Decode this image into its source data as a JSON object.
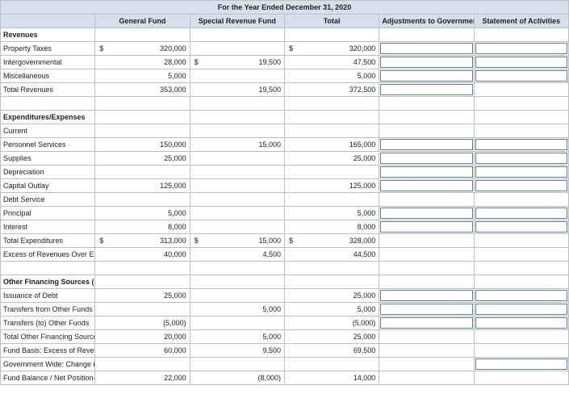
{
  "title": "For the Year Ended December 31, 2020",
  "columns": {
    "general": "General Fund",
    "special": "Special Revenue Fund",
    "total": "Total",
    "adjust": "Adjustments to Government-wide",
    "activities": "Statement of Activities"
  },
  "rows": [
    {
      "label": "Revenues",
      "style": "bold"
    },
    {
      "label": "Property Taxes",
      "g": "320,000",
      "gs": "$",
      "t": "320,000",
      "ts": "$",
      "inputs": [
        true,
        true
      ]
    },
    {
      "label": "Intergovernmental",
      "g": "28,000",
      "s": "19,500",
      "ss": "$",
      "t": "47,500",
      "inputs": [
        true,
        true
      ]
    },
    {
      "label": "Miscellaneous",
      "g": "5,000",
      "t": "5,000",
      "inputs": [
        true,
        true
      ]
    },
    {
      "label": "Total Revenues",
      "indent": 2,
      "g": "353,000",
      "s": "19,500",
      "t": "372,500",
      "inputs": [
        true,
        false
      ]
    },
    {
      "label": "",
      "blank": true
    },
    {
      "label": "Expenditures/Expenses",
      "style": "bold"
    },
    {
      "label": "Current"
    },
    {
      "label": "Personnel Services",
      "indent": 1,
      "g": "150,000",
      "s": "15,000",
      "t": "165,000",
      "inputs": [
        true,
        true
      ]
    },
    {
      "label": "Supplies",
      "indent": 1,
      "g": "25,000",
      "t": "25,000",
      "inputs": [
        true,
        true
      ]
    },
    {
      "label": "Depreciation",
      "indent": 1,
      "inputs": [
        true,
        true
      ]
    },
    {
      "label": "Capital Outlay",
      "g": "125,000",
      "t": "125,000",
      "inputs": [
        true,
        true
      ]
    },
    {
      "label": "Debt Service"
    },
    {
      "label": "Principal",
      "indent": 1,
      "g": "5,000",
      "t": "5,000",
      "inputs": [
        true,
        true
      ]
    },
    {
      "label": "Interest",
      "indent": 1,
      "g": "8,000",
      "t": "8,000",
      "inputs": [
        true,
        true
      ]
    },
    {
      "label": "Total Expenditures",
      "indent": 2,
      "g": "313,000",
      "gs": "$",
      "s": "15,000",
      "ss": "$",
      "t": "328,000",
      "ts": "$"
    },
    {
      "label": "Excess of Revenues Over Expenditures",
      "g": "40,000",
      "s": "4,500",
      "t": "44,500"
    },
    {
      "label": "",
      "blank": true
    },
    {
      "label": "Other Financing Sources (Uses):",
      "style": "bold"
    },
    {
      "label": "Issuance of Debt",
      "g": "25,000",
      "t": "25,000",
      "inputs": [
        true,
        true
      ]
    },
    {
      "label": "Transfers from Other Funds",
      "s": "5,000",
      "t": "5,000",
      "inputs": [
        true,
        true
      ]
    },
    {
      "label": "Transfers (to) Other Funds",
      "g": "(5,000)",
      "t": "(5,000)",
      "inputs": [
        true,
        true
      ]
    },
    {
      "label": "Total Other Financing Sources",
      "indent": 2,
      "g": "20,000",
      "s": "5,000",
      "t": "25,000"
    },
    {
      "label": "Fund Basis: Excess of Revenues and Other Sources Over (Under) Expenditures and Other Uses",
      "tall": true,
      "g": "60,000",
      "s": "9,500",
      "t": "69,500"
    },
    {
      "label": "Government Wide: Change in Net Position",
      "inputs": [
        false,
        true
      ]
    },
    {
      "label": "Fund Balance / Net Position—Beginning of Year",
      "g": "22,000",
      "s": "(8,000)",
      "t": "14,000"
    }
  ]
}
